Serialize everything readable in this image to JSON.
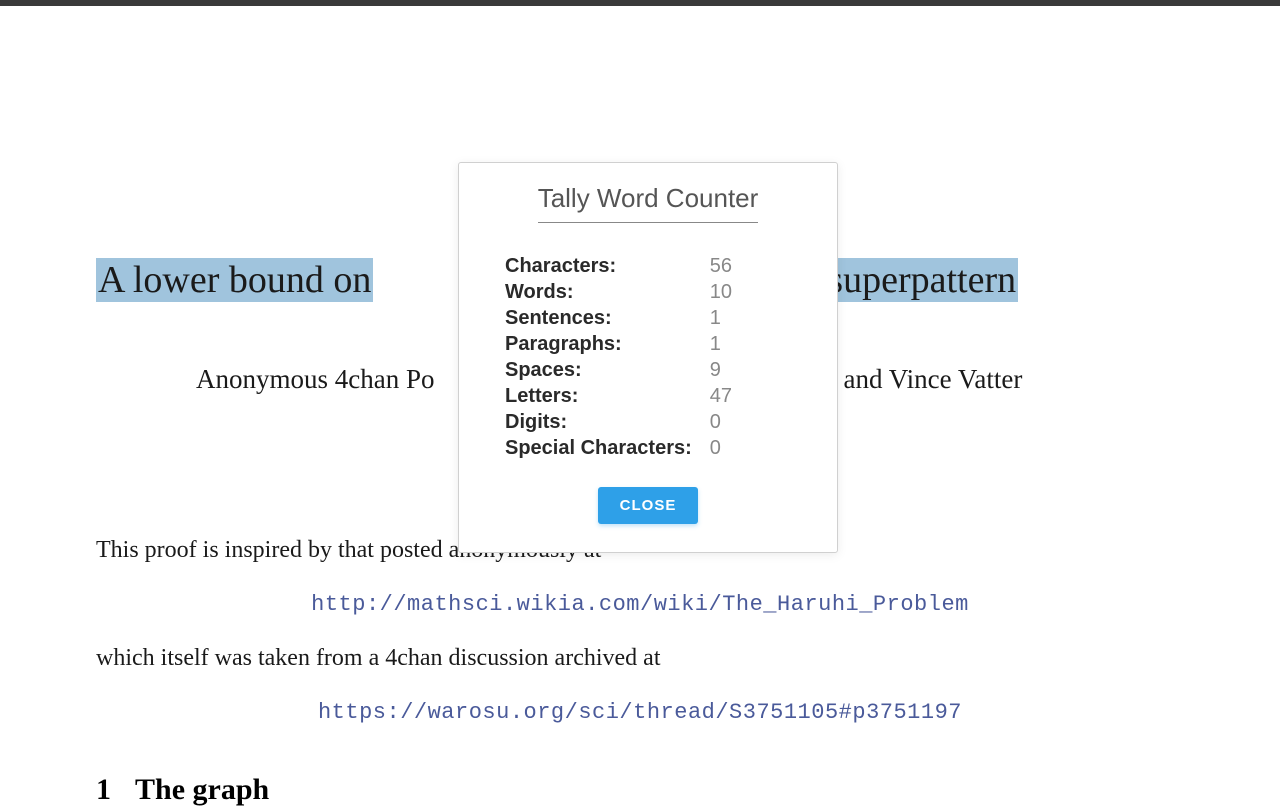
{
  "document": {
    "title_left": "A lower bound on",
    "title_right": "rtest superpattern",
    "authors_left": "Anonymous 4chan Po",
    "authors_right": "ne, and Vince Vatter",
    "body1": "This proof is inspired by that posted anonymously at",
    "link1": "http://mathsci.wikia.com/wiki/The_Haruhi_Problem",
    "body2": "which itself was taken from a 4chan discussion archived at",
    "link2": "https://warosu.org/sci/thread/S3751105#p3751197",
    "section_num": "1",
    "section_title": "The graph"
  },
  "popup": {
    "title": "Tally Word Counter",
    "stats": [
      {
        "label": "Characters:",
        "value": "56"
      },
      {
        "label": "Words:",
        "value": "10"
      },
      {
        "label": "Sentences:",
        "value": "1"
      },
      {
        "label": "Paragraphs:",
        "value": "1"
      },
      {
        "label": "Spaces:",
        "value": "9"
      },
      {
        "label": "Letters:",
        "value": "47"
      },
      {
        "label": "Digits:",
        "value": "0"
      },
      {
        "label": "Special Characters:",
        "value": "0"
      }
    ],
    "close_label": "CLOSE"
  }
}
